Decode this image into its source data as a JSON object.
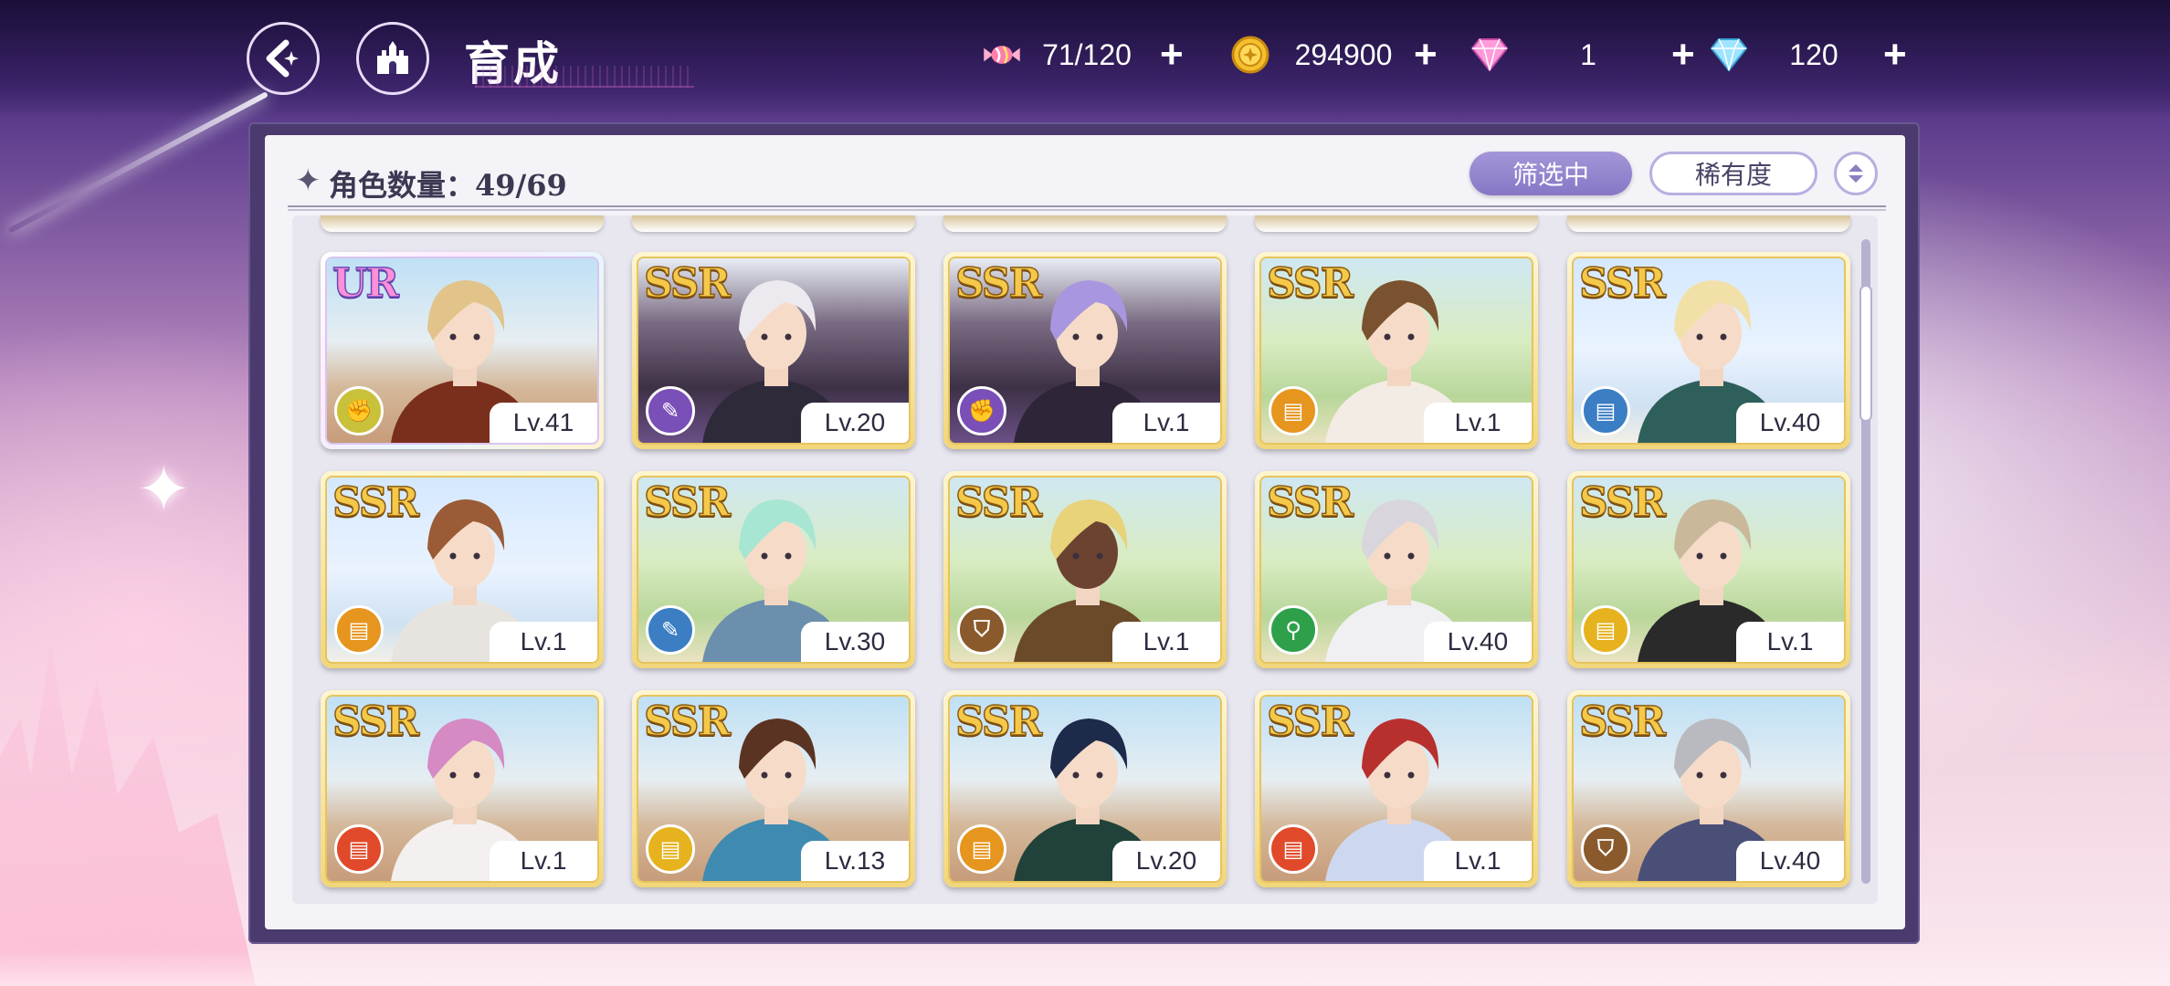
{
  "header": {
    "title": "育成",
    "back_icon": "back-arrow-sparkle-icon",
    "home_icon": "castle-icon"
  },
  "resources": [
    {
      "icon": "candy-icon",
      "value": "71/120",
      "color": "#ff8fb8"
    },
    {
      "icon": "gold-coin-icon",
      "value": "294900",
      "color": "#f5c02e"
    },
    {
      "icon": "pink-diamond-icon",
      "value": "1",
      "color": "#ff7fd0"
    },
    {
      "icon": "blue-diamond-icon",
      "value": "120",
      "color": "#7fd6ff"
    }
  ],
  "panel": {
    "count_label": "角色数量：49/69",
    "filter_button": "筛选中",
    "rarity_button": "稀有度",
    "sort_icon": "sort-toggle-icon"
  },
  "cards": [
    {
      "rarity": "UR",
      "level": "Lv.41",
      "class_color": "#c9c13a",
      "class_icon": "fist-icon",
      "scene": "town"
    },
    {
      "rarity": "SSR",
      "level": "Lv.20",
      "class_color": "#7a4fb8",
      "class_icon": "scroll-icon",
      "scene": "dark"
    },
    {
      "rarity": "SSR",
      "level": "Lv.1",
      "class_color": "#7a4fb8",
      "class_icon": "fist-icon",
      "scene": "dark"
    },
    {
      "rarity": "SSR",
      "level": "Lv.1",
      "class_color": "#e6951e",
      "class_icon": "book-icon",
      "scene": "garden"
    },
    {
      "rarity": "SSR",
      "level": "Lv.40",
      "class_color": "#3b7ec4",
      "class_icon": "book-icon",
      "scene": "sky"
    },
    {
      "rarity": "SSR",
      "level": "Lv.1",
      "class_color": "#e6951e",
      "class_icon": "book-icon",
      "scene": "sky"
    },
    {
      "rarity": "SSR",
      "level": "Lv.30",
      "class_color": "#3b7ec4",
      "class_icon": "scroll-icon",
      "scene": "garden"
    },
    {
      "rarity": "SSR",
      "level": "Lv.1",
      "class_color": "#8a5a2c",
      "class_icon": "shield-icon",
      "scene": "garden"
    },
    {
      "rarity": "SSR",
      "level": "Lv.40",
      "class_color": "#2ea04a",
      "class_icon": "staff-icon",
      "scene": "garden"
    },
    {
      "rarity": "SSR",
      "level": "Lv.1",
      "class_color": "#e6b21e",
      "class_icon": "book-icon",
      "scene": "garden"
    },
    {
      "rarity": "SSR",
      "level": "Lv.1",
      "class_color": "#e04a2a",
      "class_icon": "book-icon",
      "scene": "town"
    },
    {
      "rarity": "SSR",
      "level": "Lv.13",
      "class_color": "#e6b21e",
      "class_icon": "book-icon",
      "scene": "town"
    },
    {
      "rarity": "SSR",
      "level": "Lv.20",
      "class_color": "#e6951e",
      "class_icon": "book-icon",
      "scene": "town"
    },
    {
      "rarity": "SSR",
      "level": "Lv.1",
      "class_color": "#e04a2a",
      "class_icon": "book-icon",
      "scene": "town"
    },
    {
      "rarity": "SSR",
      "level": "Lv.40",
      "class_color": "#8a5a2c",
      "class_icon": "shield-icon",
      "scene": "town"
    }
  ]
}
